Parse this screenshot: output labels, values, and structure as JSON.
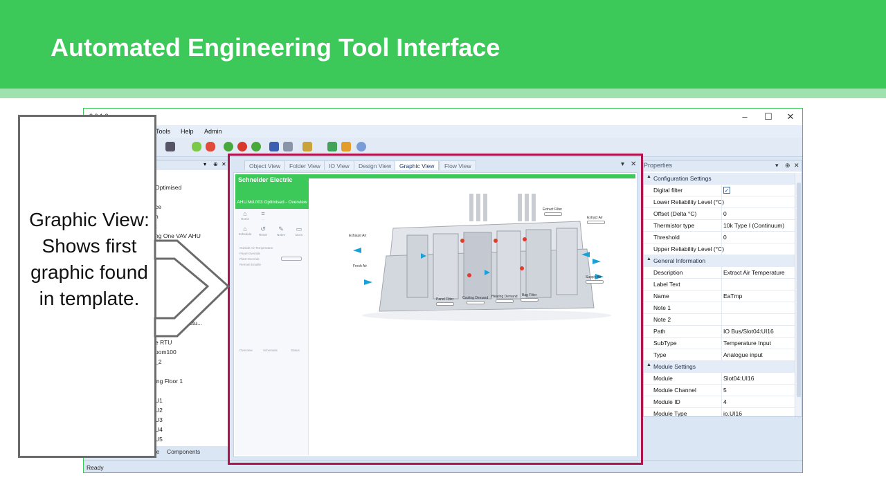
{
  "banner": {
    "title": "Automated Engineering Tool Interface"
  },
  "callout": {
    "text": "Graphic View: Shows first graphic found in template."
  },
  "app": {
    "title_visible": "2.0.1.2",
    "menu": [
      "Tools",
      "Help",
      "Admin"
    ],
    "status": "Ready"
  },
  "left_dock": {
    "tree_items": [
      "Optimised",
      "ce",
      "n",
      "t",
      "ng One VAV AHU",
      "ed  Flat  ...structu...",
      "opUnit",
      "e RTU",
      "oom100",
      "_2",
      "ing  Floor 1",
      "U1",
      "U2",
      "U3",
      "U4",
      "U5"
    ],
    "tabs": [
      "ee",
      "Components"
    ]
  },
  "document": {
    "tabs": [
      "Object View",
      "Folder View",
      "IO View",
      "Design View",
      "Graphic View",
      "Flow View"
    ],
    "active_tab": "Graphic View",
    "graphic": {
      "logo": "Schneider Electric",
      "header": "AHU.Md.003 Optimised - Overview",
      "side_icons": [
        "Home",
        "...",
        "Schedule",
        "Reset",
        "Notes",
        "Docs"
      ],
      "side_rows": [
        "Outside Air Temperature",
        "Panel Override",
        "Plant Override",
        "Remote Enable"
      ],
      "side_tabs": [
        "Overview",
        "Schematic",
        "Status"
      ],
      "labels": {
        "exhaust_air": "Exhaust Air",
        "fresh_air": "Fresh Air",
        "extract_filter": "Extract Filter",
        "extract_air": "Extract Air",
        "supply_air": "Supply Air",
        "panel_filter": "Panel Filter",
        "cooling_demand": "Cooling Demand",
        "heating_demand": "Heating Demand",
        "bag_filter": "Bag Filter"
      }
    }
  },
  "properties": {
    "title": "Properties",
    "categories": [
      {
        "name": "Configuration Settings",
        "rows": [
          {
            "name": "Digital filter",
            "value": "",
            "checked": true
          },
          {
            "name": "Lower Reliability Level (°C)",
            "value": ""
          },
          {
            "name": "Offset (Delta °C)",
            "value": "0"
          },
          {
            "name": "Thermistor type",
            "value": "10k Type I (Continuum)"
          },
          {
            "name": "Threshold",
            "value": "0"
          },
          {
            "name": "Upper Reliability Level (°C)",
            "value": ""
          }
        ]
      },
      {
        "name": "General Information",
        "rows": [
          {
            "name": "Description",
            "value": "Extract Air Temperature"
          },
          {
            "name": "Label Text",
            "value": ""
          },
          {
            "name": "Name",
            "value": "EaTmp"
          },
          {
            "name": "Note 1",
            "value": ""
          },
          {
            "name": "Note 2",
            "value": ""
          },
          {
            "name": "Path",
            "value": "IO Bus/Slot04:UI16"
          },
          {
            "name": "SubType",
            "value": "Temperature Input"
          },
          {
            "name": "Type",
            "value": "Analogue input"
          }
        ]
      },
      {
        "name": "Module Settings",
        "rows": [
          {
            "name": "Module",
            "value": "Slot04:UI16"
          },
          {
            "name": "Module Channel",
            "value": "5"
          },
          {
            "name": "Module ID",
            "value": "4"
          },
          {
            "name": "Module Type",
            "value": "io.UI16"
          }
        ]
      }
    ]
  },
  "colors": {
    "banner": "#3dc95a",
    "highlight": "#b0124a",
    "accent_blue": "#1aa0d8"
  },
  "icons": [
    "minimize-icon",
    "maximize-icon",
    "close-icon",
    "dropdown-icon",
    "pin-icon"
  ]
}
